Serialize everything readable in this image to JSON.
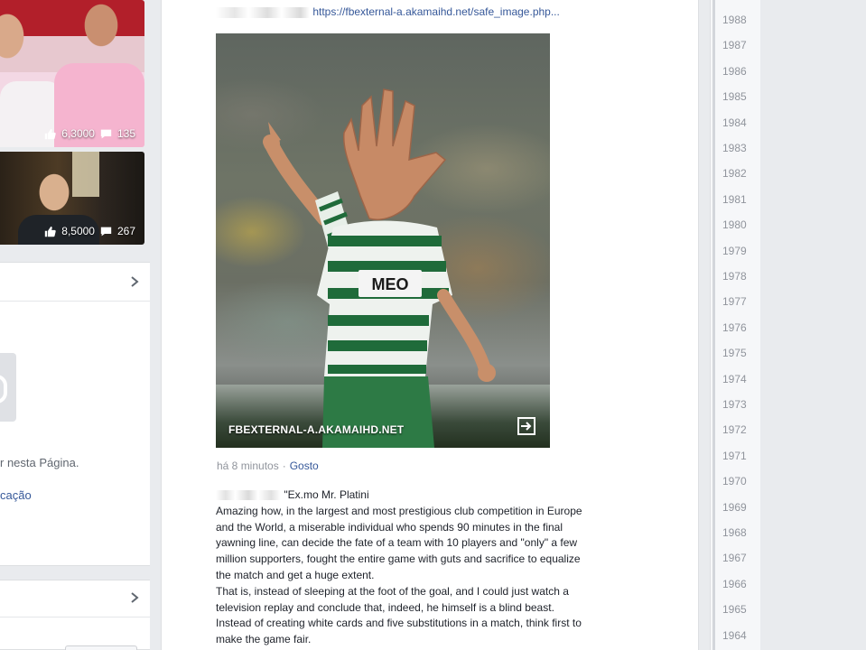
{
  "left": {
    "thumbs": [
      {
        "likes": "6,3000",
        "comments": "135"
      },
      {
        "likes": "8,5000",
        "comments": "267"
      }
    ],
    "card1": {
      "text1": "r nesta Página.",
      "text2": "cação"
    }
  },
  "post": {
    "link_url": "https://fbexternal-a.akamaihd.net/safe_image.php...",
    "image_caption": "FBEXTERNAL-A.AKAMAIHD.NET",
    "time": "há 8 minutos",
    "separator": "·",
    "like_label": "Gosto"
  },
  "comment": {
    "lines": [
      "\"Ex.mo Mr. Platini",
      "Amazing how, in the largest and most prestigious club competition in Europe",
      "and the World, a miserable individual who spends 90 minutes in the final",
      "yawning line, can decide the fate of a team with 10 players and \"only\" a few",
      "million supporters, fought the entire game with guts and sacrifice to equalize",
      "the match and get a huge extent.",
      "That is, instead of sleeping at the foot of the goal, and I could just watch a",
      "television replay and conclude that, indeed, he himself is a blind beast.",
      "Instead of creating white cards and five substitutions in a match, think first to",
      "make the game fair."
    ]
  },
  "years": [
    "1988",
    "1987",
    "1986",
    "1985",
    "1984",
    "1983",
    "1982",
    "1981",
    "1980",
    "1979",
    "1978",
    "1977",
    "1976",
    "1975",
    "1974",
    "1973",
    "1972",
    "1971",
    "1970",
    "1969",
    "1968",
    "1967",
    "1966",
    "1965",
    "1964"
  ],
  "icons": [
    "like-icon",
    "comment-icon",
    "chevron-right-icon",
    "open-link-icon"
  ],
  "colors": {
    "link": "#365899",
    "background": "#e9ebee",
    "meta": "#90949c",
    "jersey_green": "#1f6b3a"
  }
}
